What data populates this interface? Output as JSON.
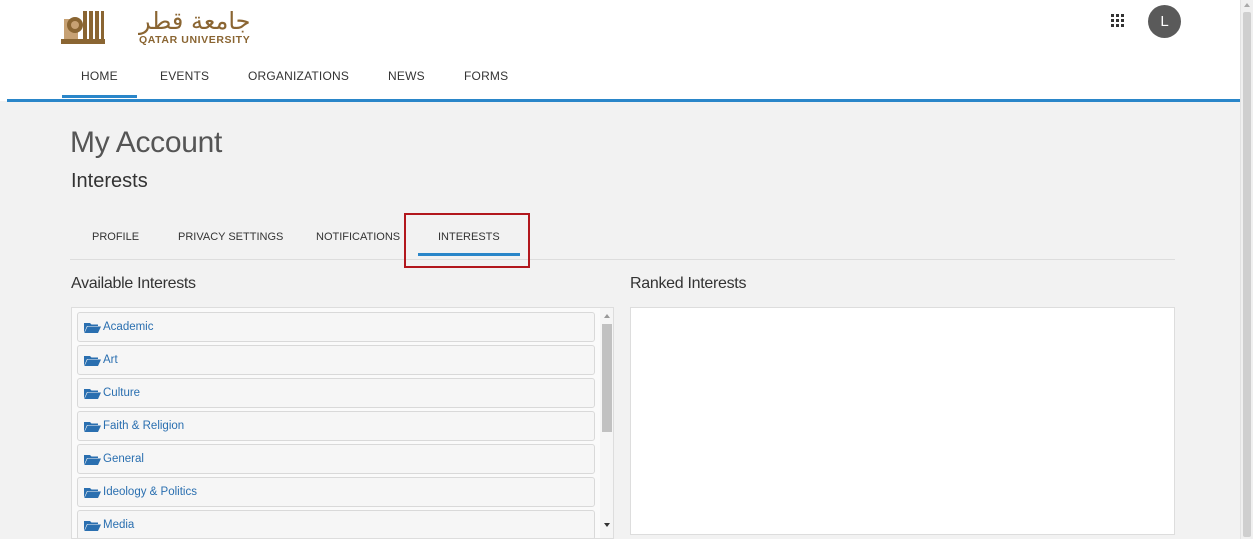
{
  "brand": {
    "arabic_name": "جامعة قطر",
    "latin_name": "QATAR UNIVERSITY"
  },
  "topnav": [
    {
      "label": "HOME",
      "active": true
    },
    {
      "label": "EVENTS",
      "active": false
    },
    {
      "label": "ORGANIZATIONS",
      "active": false
    },
    {
      "label": "NEWS",
      "active": false
    },
    {
      "label": "FORMS",
      "active": false
    }
  ],
  "header_actions": {
    "apps_icon": "grid-apps-icon",
    "avatar_initial": "L"
  },
  "page": {
    "title": "My Account",
    "section": "Interests"
  },
  "subtabs": [
    {
      "label": "PROFILE",
      "active": false
    },
    {
      "label": "PRIVACY SETTINGS",
      "active": false
    },
    {
      "label": "NOTIFICATIONS",
      "active": false
    },
    {
      "label": "INTERESTS",
      "active": true
    }
  ],
  "available": {
    "heading": "Available Interests",
    "items": [
      "Academic",
      "Art",
      "Culture",
      "Faith & Religion",
      "General",
      "Ideology & Politics",
      "Media"
    ]
  },
  "ranked": {
    "heading": "Ranked Interests"
  },
  "colors": {
    "accent": "#2a86c9",
    "brand": "#8a6532",
    "highlight": "#b2171d",
    "link": "#2a6fb0"
  }
}
